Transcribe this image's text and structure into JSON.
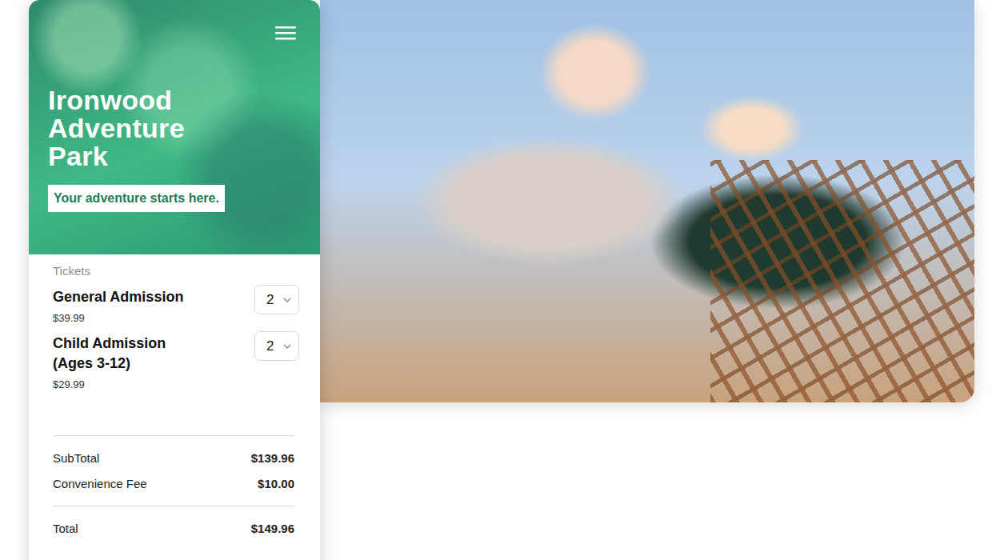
{
  "header": {
    "title": "Ironwood Adventure Park",
    "tagline": "Your adventure starts here."
  },
  "tickets": {
    "label": "Tickets",
    "items": [
      {
        "name": "General Admission",
        "price": "$39.99",
        "quantity": "2"
      },
      {
        "name": "Child Admission (Ages 3-12)",
        "price": "$29.99",
        "quantity": "2"
      }
    ]
  },
  "summary": [
    {
      "label": "SubTotal",
      "value": "$139.96"
    },
    {
      "label": "Convenience Fee",
      "value": "$10.00"
    }
  ],
  "total": {
    "label": "Total",
    "value": "$149.96"
  }
}
